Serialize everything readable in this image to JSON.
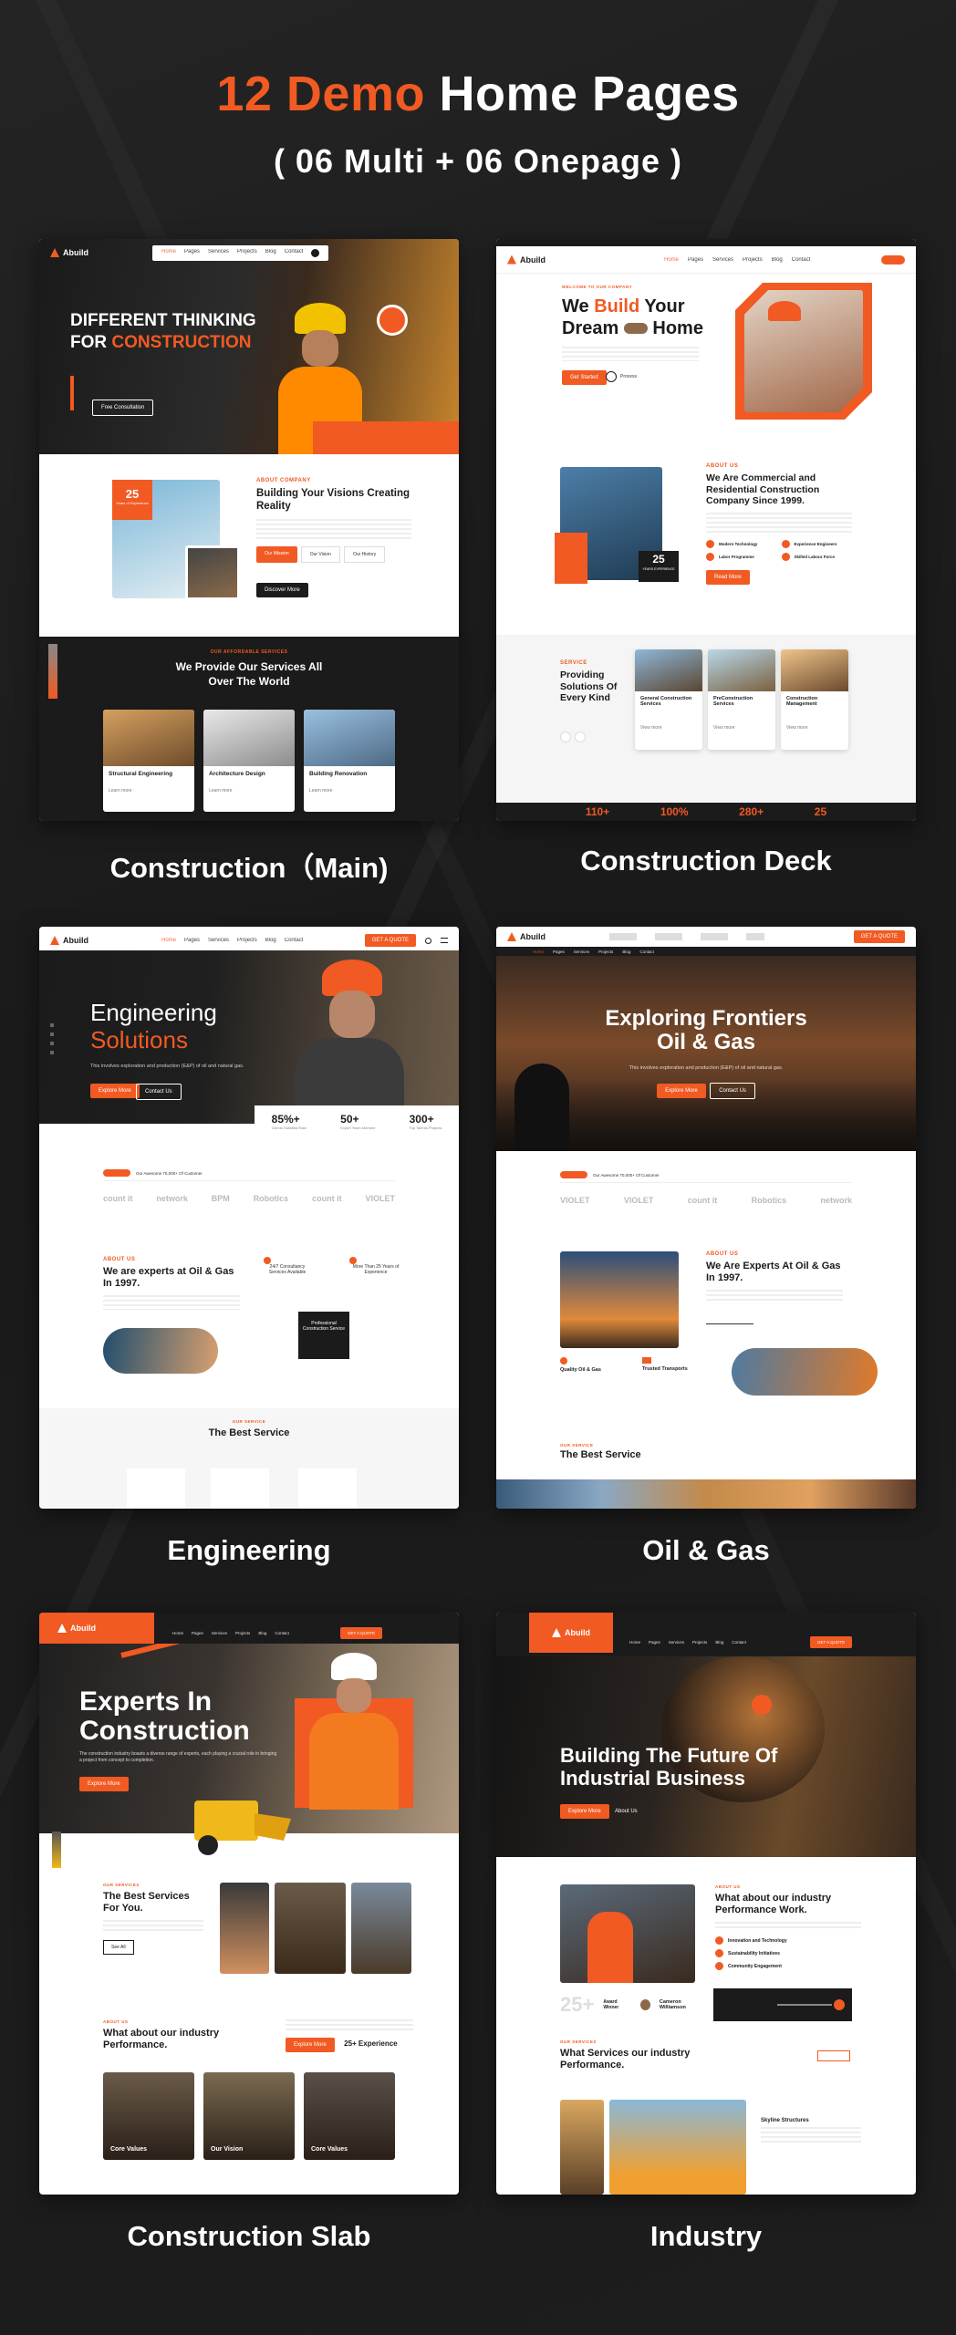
{
  "header": {
    "title_accent": "12 Demo",
    "title_rest": "Home Pages",
    "subtitle": "( 06 Multi + 06 Onepage )"
  },
  "brand": {
    "accent_color": "#f15a22",
    "dark_color": "#1b1b1b",
    "logo_text": "Abuild"
  },
  "demos": [
    {
      "caption": "Construction（Main)",
      "nav": [
        "Home",
        "Pages",
        "Services",
        "Projects",
        "Blog",
        "Contact"
      ],
      "hero_line1": "DIFFERENT THINKING",
      "hero_line2_white": "FOR",
      "hero_line2_accent": "CONSTRUCTION",
      "hero_button": "Free Consultation",
      "badge_num": "25",
      "badge_text": "Years of Experience",
      "about_tag": "ABOUT COMPANY",
      "about_title": "Building Your Visions Creating Reality",
      "about_tabs": [
        "Our Mission",
        "Our Vision",
        "Our History"
      ],
      "about_button": "Discover More",
      "services_tag": "OUR AFFORDABLE SERVICES",
      "services_title": "We Provide Our Services All Over The World",
      "services": [
        "Structural Engineering",
        "Architecture Design",
        "Building Renovation"
      ],
      "learn_more": "Learn more"
    },
    {
      "caption": "Construction Deck",
      "nav": [
        "Home",
        "Pages",
        "Services",
        "Projects",
        "Blog",
        "Contact"
      ],
      "hero_tag": "WELCOME TO OUR COMPANY",
      "hero_we": "We",
      "hero_build": "Build",
      "hero_your": "Your",
      "hero_dream": "Dream",
      "hero_home": "Home",
      "hero_button": "Get Started",
      "hero_play": "Process",
      "about_tag": "ABOUT US",
      "about_title": "We Are Commercial and Residential Construction Company Since 1999.",
      "about_features": [
        "Modern Technology",
        "Experience Engineers",
        "Labor Programme",
        "Skilled Labour Force"
      ],
      "exp_num": "25",
      "exp_text": "YEARS EXPERIENCE",
      "about_button": "Read More",
      "svc_tag": "SERVICE",
      "svc_title": "Providing Solutions Of Every Kind",
      "services": [
        "General Construction Services",
        "PreConstruction Services",
        "Construction Management"
      ],
      "view_more": "View more",
      "stats": [
        "110+",
        "100%",
        "280+",
        "25"
      ]
    },
    {
      "caption": "Engineering",
      "nav": [
        "Home",
        "Pages",
        "Services",
        "Projects",
        "Blog",
        "Contact"
      ],
      "nav_button": "GET A QUOTE",
      "hero_line1": "Engineering",
      "hero_line2": "Solutions",
      "hero_text": "This involves exploration and production (E&P) of oil and natural gas.",
      "hero_btn1": "Explore More",
      "hero_btn2": "Contact Us",
      "stats": [
        {
          "num": "85%+",
          "label": "Clients Satisfied Rate"
        },
        {
          "num": "50+",
          "label": "Expert Team Member"
        },
        {
          "num": "300+",
          "label": "Top Talents Projects"
        }
      ],
      "trusted": "Our Awesome 70,000+ Of Customer",
      "brands": [
        "count it",
        "network",
        "BPM",
        "Robotics",
        "count it",
        "VIOLET"
      ],
      "about_tag": "ABOUT US",
      "about_title": "We are experts at Oil & Gas In 1997.",
      "bubble1": "24/7 Consultancy Services Available",
      "bubble2": "More Than 25 Years of Experience",
      "bubble3": "Professional Construction Service",
      "svc_tag": "OUR SERVICE",
      "svc_title": "The Best Service"
    },
    {
      "caption": "Oil & Gas",
      "nav": [
        "Home",
        "Pages",
        "Services",
        "Projects",
        "Blog",
        "Contact"
      ],
      "nav_button": "GET A QUOTE",
      "hero_line1": "Exploring Frontiers",
      "hero_line2": "Oil & Gas",
      "hero_text": "This involves exploration and production (E&P) of oil and natural gas.",
      "hero_btn1": "Explore More",
      "hero_btn2": "Contact Us",
      "trusted": "Our Awesome 70,000+ Of Customer",
      "brands": [
        "VIOLET",
        "VIOLET",
        "count it",
        "Robotics",
        "network"
      ],
      "about_tag": "ABOUT US",
      "about_title": "We Are Experts At Oil & Gas In 1997.",
      "feat1": "Quality Oil & Gas",
      "feat2": "Trusted Transports",
      "svc_tag": "OUR SERVICE",
      "svc_title": "The Best Service"
    },
    {
      "caption": "Construction Slab",
      "nav": [
        "Home",
        "Pages",
        "Services",
        "Projects",
        "Blog",
        "Contact"
      ],
      "nav_button": "GET A QUOTE",
      "hero_line1": "Experts In",
      "hero_line2": "Construction",
      "hero_text": "The construction industry boasts a diverse range of experts, each playing a crucial role in bringing a project from concept to completion.",
      "hero_button": "Explore More",
      "svc_tag": "OUR SERVICES",
      "svc_title": "The Best Services For You.",
      "svc_button": "See All",
      "about_tag": "ABOUT US",
      "about_title": "What about our industry Performance.",
      "about_button": "Explore More",
      "exp": "25+ Experience",
      "cards": [
        "Core Values",
        "Our Vision",
        "Core Values"
      ]
    },
    {
      "caption": "Industry",
      "nav": [
        "Home",
        "Pages",
        "Services",
        "Projects",
        "Blog",
        "Contact"
      ],
      "nav_button": "GET A QUOTE",
      "hero_line1": "Building The Future Of",
      "hero_line2": "Industrial Business",
      "hero_btn1": "Explore More",
      "hero_btn2": "About Us",
      "about_tag": "ABOUT US",
      "about_title": "What about our industry Performance Work.",
      "features": [
        "Innovation and Technology",
        "Sustainability Initiatives",
        "Community Engagement"
      ],
      "exp": "25+",
      "exp_label": "Award Winner",
      "person": "Cameron Williamson",
      "svc_tag": "OUR SERVICES",
      "svc_title": "What Services our industry Performance.",
      "svc_card": "Skyline Structures"
    }
  ]
}
